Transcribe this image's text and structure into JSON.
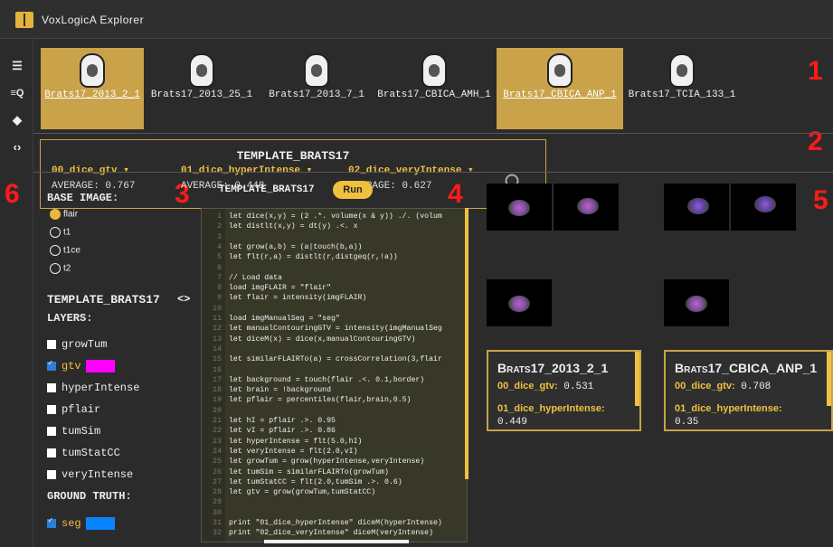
{
  "app": {
    "title": "VoxLogicA Explorer"
  },
  "annotations": [
    "1",
    "2",
    "3",
    "4",
    "5",
    "6"
  ],
  "nav": {
    "icons": [
      "menu-icon",
      "query-list-icon",
      "layers-icon",
      "code-icon"
    ]
  },
  "cases": [
    {
      "label": "Brats17_2013_2_1",
      "selected": true
    },
    {
      "label": "Brats17_2013_25_1",
      "selected": false
    },
    {
      "label": "Brats17_2013_7_1",
      "selected": false
    },
    {
      "label": "Brats17_CBICA_AMH_1",
      "selected": false
    },
    {
      "label": "Brats17_CBICA_ANP_1",
      "selected": true
    },
    {
      "label": "Brats17_TCIA_133_1",
      "selected": false
    }
  ],
  "template": {
    "title": "TEMPLATE_BRATS17",
    "metrics": [
      {
        "name": "00_dice_gtv",
        "avg": "AVERAGE: 0.767"
      },
      {
        "name": "01_dice_hyperIntense",
        "avg": "AVERAGE: 0.448"
      },
      {
        "name": "02_dice_veryIntense",
        "avg": "AVERAGE: 0.627"
      }
    ]
  },
  "left": {
    "base_label": "BASE IMAGE:",
    "base_images": [
      "flair",
      "t1",
      "t1ce",
      "t2"
    ],
    "selected_base": "flair",
    "template_label": "TEMPLATE_BRATS17",
    "code_toggle": "<>",
    "layers_label": "LAYERS:",
    "layers": [
      {
        "name": "growTum",
        "checked": false,
        "color": ""
      },
      {
        "name": "gtv",
        "checked": true,
        "color": "#ff00ff"
      },
      {
        "name": "hyperIntense",
        "checked": false,
        "color": ""
      },
      {
        "name": "pflair",
        "checked": false,
        "color": ""
      },
      {
        "name": "tumSim",
        "checked": false,
        "color": ""
      },
      {
        "name": "tumStatCC",
        "checked": false,
        "color": ""
      },
      {
        "name": "veryIntense",
        "checked": false,
        "color": ""
      }
    ],
    "ground_label": "GROUND TRUTH:",
    "ground": [
      {
        "name": "seg",
        "checked": true,
        "color": "#0a84ff"
      }
    ]
  },
  "editor": {
    "title": "TEMPLATE_BRATS17",
    "run_label": "Run",
    "lines": [
      "let dice(x,y) = (2 .*. volume(x & y)) ./. (volum",
      "let distlt(x,y) = dt(y) .<. x",
      "",
      "let grow(a,b) = (a|touch(b,a))",
      "let flt(r,a) = distlt(r,distgeq(r,!a))",
      "",
      "// Load data",
      "load imgFLAIR = \"flair\"",
      "let flair = intensity(imgFLAIR)",
      "",
      "load imgManualSeg = \"seg\"",
      "let manualContouringGTV = intensity(imgManualSeg",
      "let diceM(x) = dice(x,manualContouringGTV)",
      "",
      "let similarFLAIRTo(a) = crossCorrelation(3,flair",
      "",
      "let background = touch(flair .<. 0.1,border)",
      "let brain = !background",
      "let pflair = percentiles(flair,brain,0.5)",
      "",
      "let hI = pflair .>. 0.95",
      "let vI = pflair .>. 0.86",
      "let hyperIntense = flt(5.0,hI)",
      "let veryIntense = flt(2.0,vI)",
      "let growTum = grow(hyperIntense,veryIntense)",
      "let tumSim = similarFLAIRTo(growTum)",
      "let tumStatCC = flt(2.0,tumSim .>. 0.6)",
      "let gtv = grow(growTum,tumStatCC)",
      "",
      "",
      "print \"01_dice_hyperIntense\" diceM(hyperIntense)",
      "print \"02_dice_veryIntense\" diceM(veryIntense)"
    ]
  },
  "results": [
    {
      "title": "Brats17_2013_2_1",
      "m1_label": "00_dice_gtv:",
      "m1_value": "0.531",
      "m2_label": "01_dice_hyperIntense:",
      "m2_value": "0.449"
    },
    {
      "title": "Brats17_CBICA_ANP_1",
      "m1_label": "00_dice_gtv:",
      "m1_value": "0.708",
      "m2_label": "01_dice_hyperIntense:",
      "m2_value": "0.35"
    }
  ]
}
